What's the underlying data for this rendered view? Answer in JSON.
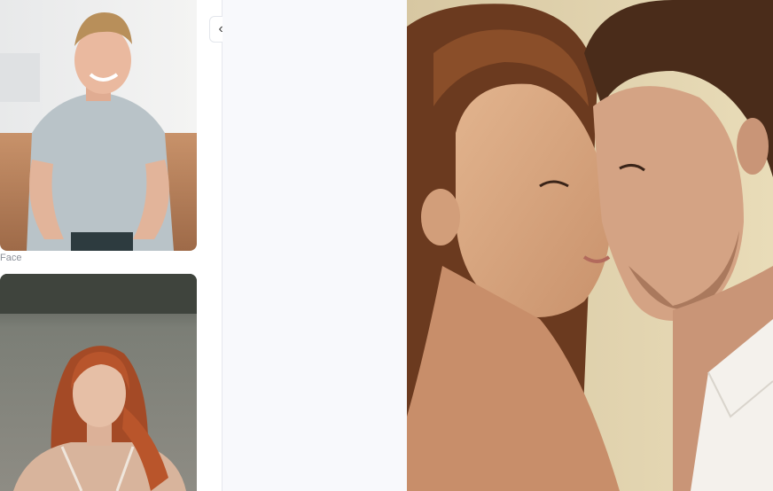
{
  "left_panel": {
    "thumbnails": [
      {
        "icon": "portrait-man-icon"
      },
      {
        "caption": "Face",
        "icon": "portrait-woman-icon"
      }
    ]
  },
  "collapse_button": {
    "icon": "chevrons-left-icon",
    "glyph": "«"
  },
  "result": {
    "icon": "couple-image-icon"
  }
}
